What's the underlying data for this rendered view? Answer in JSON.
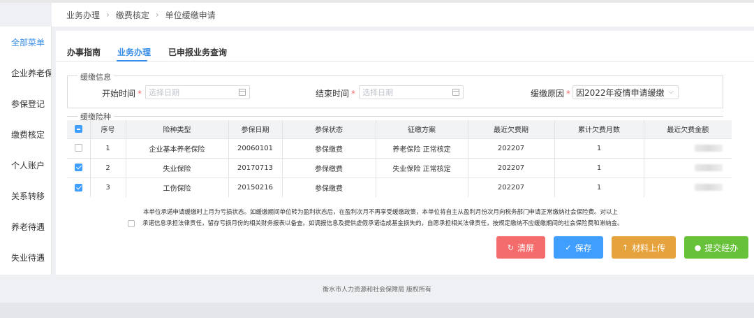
{
  "breadcrumb": [
    "业务办理",
    "缴费核定",
    "单位缓缴申请"
  ],
  "sidebar": {
    "items": [
      {
        "label": "全部菜单",
        "active": true
      },
      {
        "label": "企业养老保险",
        "active": false
      },
      {
        "label": "参保登记",
        "active": false
      },
      {
        "label": "缴费核定",
        "active": false
      },
      {
        "label": "个人账户",
        "active": false
      },
      {
        "label": "关系转移",
        "active": false
      },
      {
        "label": "养老待遇",
        "active": false
      },
      {
        "label": "失业待遇",
        "active": false
      }
    ]
  },
  "tabs": [
    {
      "label": "办事指南",
      "active": false
    },
    {
      "label": "业务办理",
      "active": true
    },
    {
      "label": "已申报业务查询",
      "active": false
    }
  ],
  "deferral_info": {
    "legend": "缓缴信息",
    "start_label": "开始时间",
    "start_placeholder": "选择日期",
    "end_label": "结束时间",
    "end_placeholder": "选择日期",
    "reason_label": "缓缴原因",
    "reason_value": "因2022年疫情申请缓缴",
    "required_mark": "*"
  },
  "insurance": {
    "legend": "缓缴险种",
    "columns": [
      "序号",
      "险种类型",
      "参保日期",
      "参保状态",
      "征缴方案",
      "最近欠费期",
      "累计欠费月数",
      "最近欠费金额"
    ],
    "rows": [
      {
        "checked": false,
        "no": "1",
        "type": "企业基本养老保险",
        "date": "20060101",
        "status": "参保缴费",
        "plan": "养老保险 正常核定",
        "period": "202207",
        "months": "1"
      },
      {
        "checked": true,
        "no": "2",
        "type": "失业保险",
        "date": "20170713",
        "status": "参保缴费",
        "plan": "失业保险 正常核定",
        "period": "202207",
        "months": "1"
      },
      {
        "checked": true,
        "no": "3",
        "type": "工伤保险",
        "date": "20150216",
        "status": "参保缴费",
        "plan": "",
        "period": "202207",
        "months": "1"
      }
    ]
  },
  "promise": {
    "line1": "本单位承诺申请缓缴时上月为亏损状态。如缓缴期间单位转为盈利状态后，在盈利次月不再享受缓缴政策，本单位将自主从盈利月份次月向税务部门申请正常缴纳社会保险费。对以上",
    "line2": "承诺信息承担法律责任，留存亏损月份的相关财务报表以备查。如调报信息及提供虚假承诺造成基金损失的，自愿承担相关法律责任，按规定缴纳不应缓缴期间的社会保险费和滞纳金。"
  },
  "buttons": {
    "clear": "清屏",
    "save": "保存",
    "upload": "材料上传",
    "submit": "提交经办"
  },
  "colors": {
    "accent": "#3a8ee6",
    "clear": "#f56c6c",
    "save": "#409eff",
    "upload": "#e6a23c",
    "submit": "#67c23a"
  },
  "footer": "衡水市人力资源和社会保障局  版权所有"
}
